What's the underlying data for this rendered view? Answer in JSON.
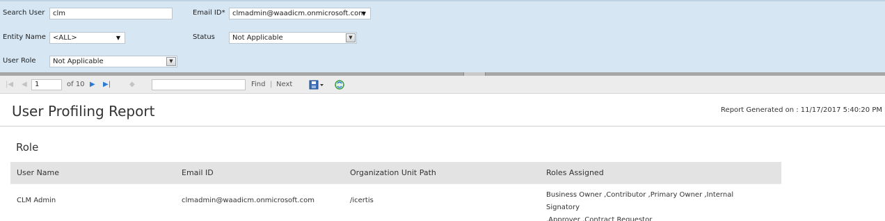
{
  "params": {
    "search_user_label": "Search User",
    "search_user_value": "clm",
    "email_label": "Email ID*",
    "email_value": "clmadmin@waadicm.onmicrosoft.com",
    "entity_label": "Entity Name",
    "entity_value": "<ALL>",
    "status_label": "Status",
    "status_value": "Not Applicable",
    "role_label": "User Role",
    "role_value": "Not Applicable"
  },
  "toolbar": {
    "page_value": "1",
    "page_of": "of 10",
    "find_value": "",
    "find_label": "Find",
    "separator": "|",
    "next_label": "Next",
    "icons": {
      "first": "first-page-icon",
      "prev": "prev-page-icon",
      "next": "next-page-icon",
      "last": "last-page-icon",
      "back": "back-icon",
      "export": "export-save-icon",
      "refresh": "refresh-icon"
    }
  },
  "report": {
    "title": "User Profiling Report",
    "generated": "Report Generated on : 11/17/2017 5:40:20 PM",
    "section": "Role",
    "columns": [
      "User Name",
      "Email ID",
      "Organization Unit Path",
      "Roles Assigned"
    ],
    "rows": [
      {
        "user_name": "CLM Admin",
        "email": "clmadmin@waadicm.onmicrosoft.com",
        "path": "/icertis",
        "roles_line1": "Business Owner ,Contributor ,Primary Owner ,Internal Signatory",
        "roles_line2": ",Approver ,Contract Requestor"
      }
    ]
  },
  "colors": {
    "panel_bg": "#d6e6f3",
    "toolbar_bg": "#ececec",
    "header_bg": "#e3e3e3",
    "accent_blue": "#2a7bd6"
  }
}
